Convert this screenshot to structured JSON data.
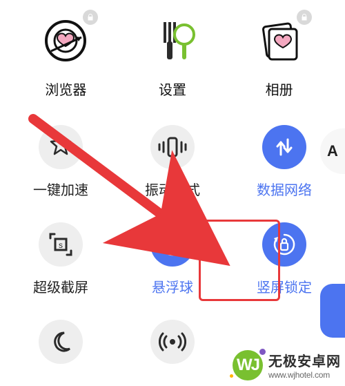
{
  "colors": {
    "accent_blue": "#4c74f0",
    "tile_off": "#eeeeee",
    "arrow_red": "#e8383a",
    "brand_green": "#79c030"
  },
  "apps": {
    "browser": {
      "label": "浏览器",
      "icon": "heart-target-icon",
      "locked": true
    },
    "settings": {
      "label": "设置",
      "icon": "utensils-icon",
      "locked": false
    },
    "gallery": {
      "label": "相册",
      "icon": "photo-stack-icon",
      "locked": true
    }
  },
  "toggles": {
    "boost": {
      "label": "一键加速",
      "icon": "star-burst-icon",
      "active": false
    },
    "vibrate": {
      "label": "振动模式",
      "icon": "vibrate-icon",
      "active": false
    },
    "data": {
      "label": "数据网络",
      "icon": "data-arrows-icon",
      "active": true
    },
    "screenshot": {
      "label": "超级截屏",
      "icon": "screenshot-crop-icon",
      "active": false
    },
    "float": {
      "label": "悬浮球",
      "icon": "target-rings-icon",
      "active": true
    },
    "portrait": {
      "label": "竖屏锁定",
      "icon": "rotation-lock-icon",
      "active": true
    },
    "dnd": {
      "label": "",
      "icon": "moon-icon",
      "active": false
    },
    "hotspot": {
      "label": "",
      "icon": "hotspot-icon",
      "active": false
    }
  },
  "side_pill": {
    "text": "A"
  },
  "watermark": {
    "logo_text": "WJ",
    "title": "无极安卓网",
    "url": "www.wjhotel.com"
  },
  "annotations": {
    "highlight_toggle": "portrait",
    "arrow_from_toggle": "boost",
    "arrow_to_toggle": "portrait"
  }
}
